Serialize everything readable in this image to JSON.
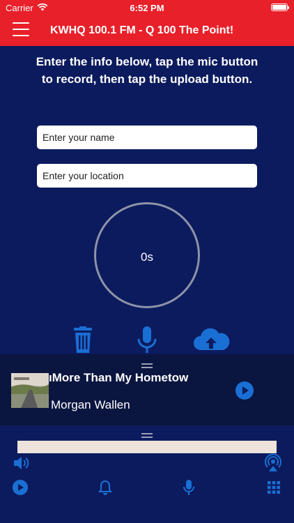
{
  "status_bar": {
    "carrier": "Carrier",
    "time": "6:52 PM"
  },
  "header": {
    "title": "KWHQ 100.1 FM - Q 100 The Point!"
  },
  "form": {
    "instructions": "Enter the info below, tap the mic button to record, then tap the upload button.",
    "name_placeholder": "Enter your name",
    "location_placeholder": "Enter your location",
    "timer": "0s"
  },
  "now_playing": {
    "title": "ıMore Than My Hometow",
    "artist": "Morgan Wallen"
  },
  "colors": {
    "header": "#e8202a",
    "background": "#0c1b5e",
    "accent": "#1a6fd4"
  },
  "icons": [
    "menu-icon",
    "trash-icon",
    "mic-icon",
    "upload-cloud-icon",
    "play-icon",
    "volume-icon",
    "airplay-icon",
    "bell-icon",
    "grid-icon"
  ]
}
